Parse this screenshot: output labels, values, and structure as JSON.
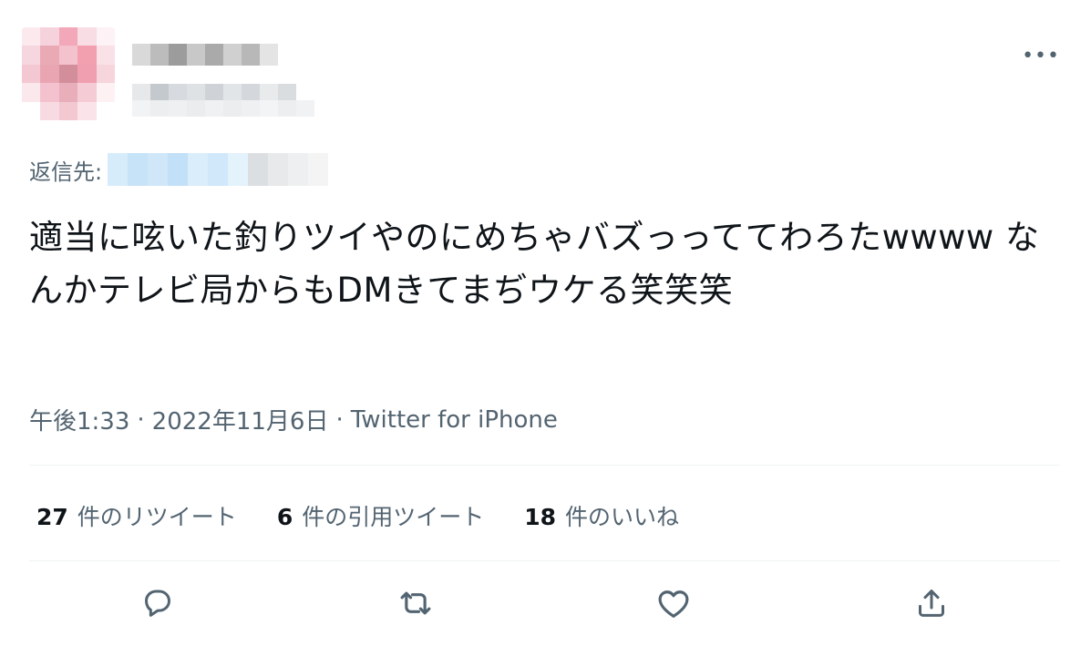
{
  "tweet": {
    "more_label": "•••",
    "reply_to_prefix": "返信先:",
    "text": "適当に呟いた釣りツイやのにめちゃバズっっててわろたwwww なんかテレビ局からもDMきてまぢウケる笑笑笑",
    "time": "午後1:33",
    "separator": "·",
    "date": "2022年11月6日",
    "source": "Twitter for iPhone"
  },
  "stats": {
    "retweets": {
      "count": "27",
      "label": "件のリツイート"
    },
    "quotes": {
      "count": "6",
      "label": "件の引用ツイート"
    },
    "likes": {
      "count": "18",
      "label": "件のいいね"
    }
  },
  "actions": [
    "reply-icon",
    "retweet-icon",
    "like-icon",
    "share-icon"
  ],
  "colors": {
    "text": "#0f1419",
    "secondary": "#536471",
    "divider": "#eff3f4",
    "avatar_pink": "#f2a7b7",
    "reply_blue": "#c6e3f8"
  }
}
